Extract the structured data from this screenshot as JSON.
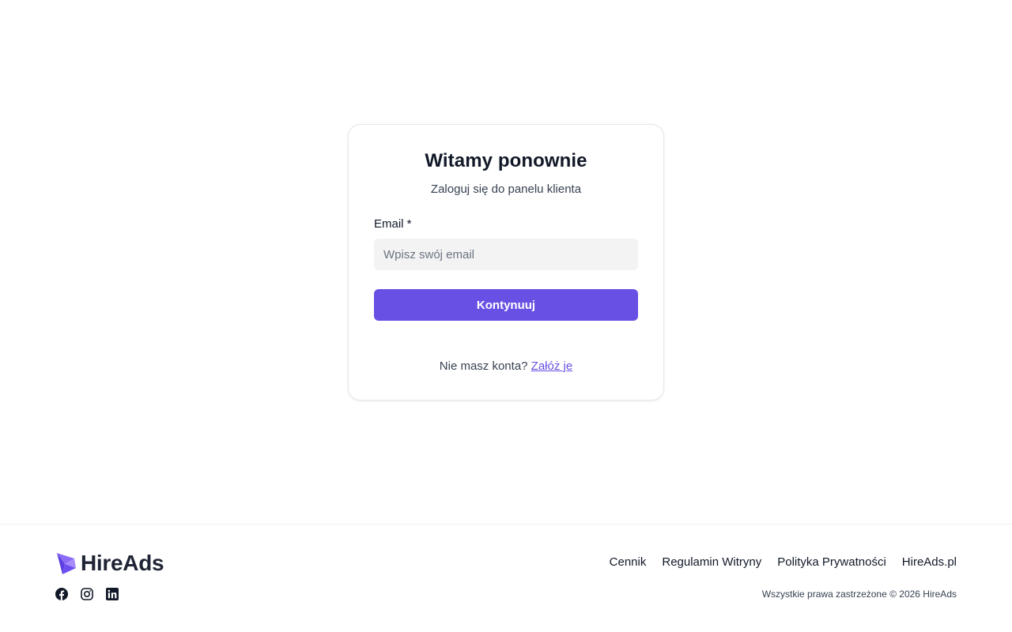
{
  "login": {
    "title": "Witamy ponownie",
    "subtitle": "Zaloguj się do panelu klienta",
    "email_label": "Email *",
    "email_placeholder": "Wpisz swój email",
    "email_value": "",
    "continue_label": "Kontynuuj",
    "no_account_text": "Nie masz konta?",
    "signup_link": "Załóż je"
  },
  "footer": {
    "logo_text": "HireAds",
    "social": [
      "facebook-icon",
      "instagram-icon",
      "linkedin-icon"
    ],
    "nav": [
      "Cennik",
      "Regulamin Witryny",
      "Polityka Prywatności",
      "HireAds.pl"
    ],
    "copyright": "Wszystkie prawa zastrzeżone © 2026 HireAds"
  },
  "colors": {
    "accent": "#6750e3",
    "text_dark": "#111827",
    "input_bg": "#f3f3f3"
  }
}
